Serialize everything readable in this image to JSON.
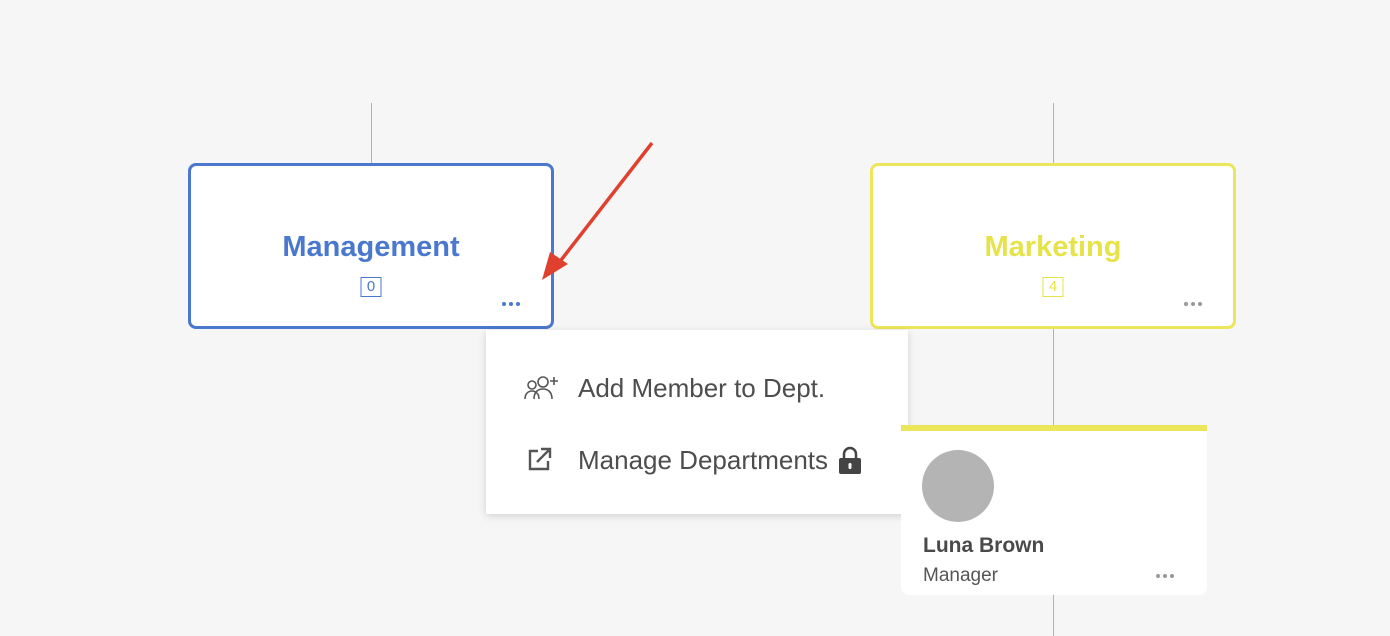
{
  "departments": [
    {
      "name": "Management",
      "count": "0",
      "color": "#4a78cf"
    },
    {
      "name": "Marketing",
      "count": "4",
      "color": "#ece75a"
    }
  ],
  "menu": {
    "items": [
      {
        "label": "Add Member to Dept.",
        "icon": "add-people-icon"
      },
      {
        "label": "Manage Departments",
        "icon": "external-link-icon",
        "locked": true
      }
    ]
  },
  "person": {
    "name": "Luna Brown",
    "role": "Manager",
    "accent": "#ece75a"
  },
  "annotation": {
    "arrow_color": "#e0412f"
  }
}
